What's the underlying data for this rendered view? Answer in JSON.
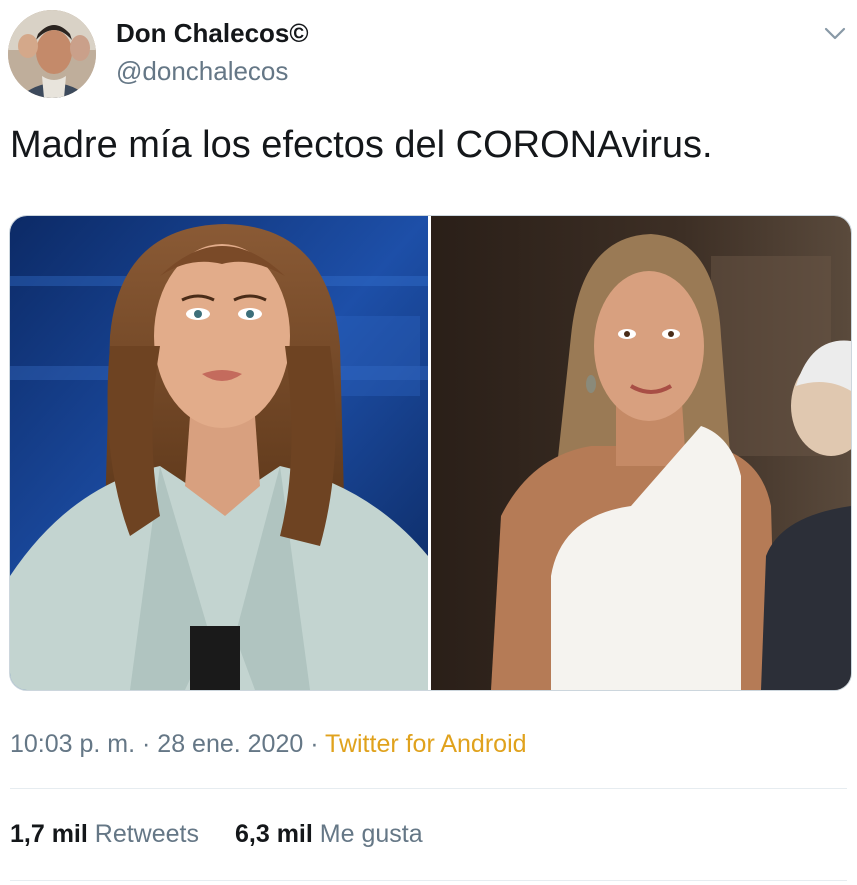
{
  "author": {
    "name": "Don Chalecos©",
    "handle": "@donchalecos"
  },
  "tweet": {
    "text": "Madre mía los efectos del CORONAvirus."
  },
  "meta": {
    "time": "10:03 p. m.",
    "separator": " · ",
    "date": "28 ene. 2020",
    "source": "Twitter for Android"
  },
  "stats": {
    "retweets_count": "1,7 mil",
    "retweets_label": "Retweets",
    "likes_count": "6,3 mil",
    "likes_label": "Me gusta"
  },
  "icons": {
    "menu": "chevron-down-icon"
  },
  "colors": {
    "source_link": "#e0a21d",
    "secondary_text": "#657786"
  }
}
